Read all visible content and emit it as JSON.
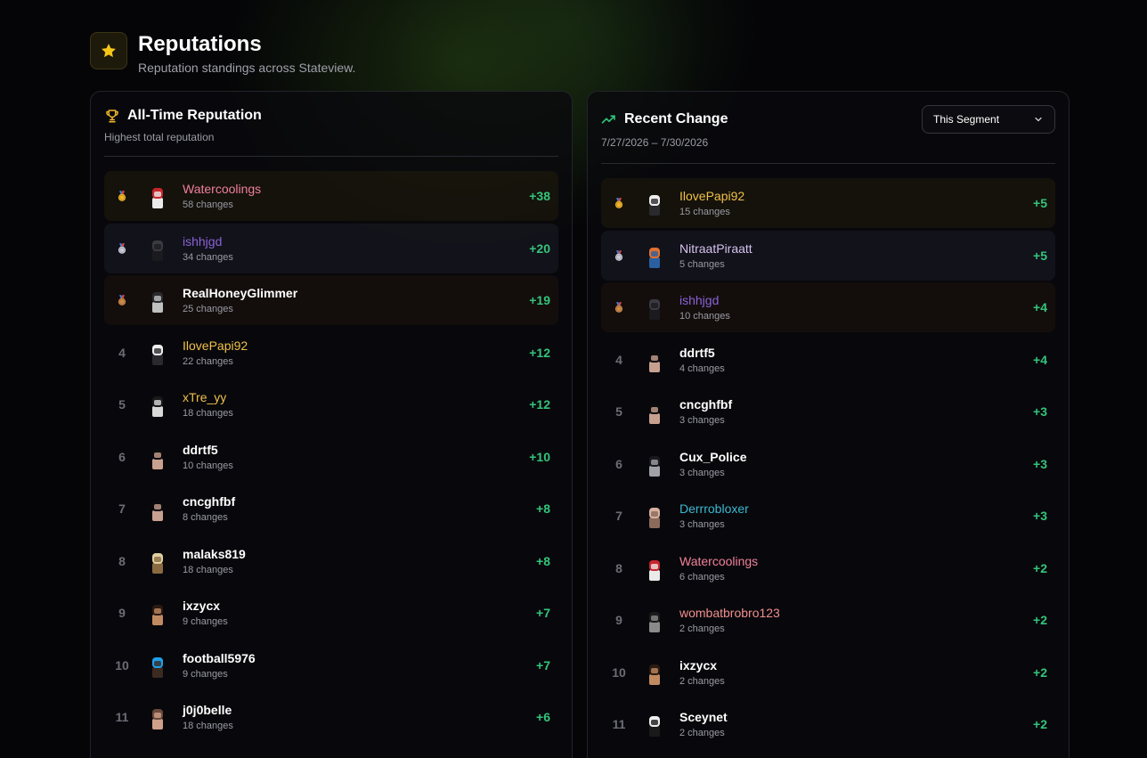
{
  "header": {
    "icon": "star-icon",
    "title": "Reputations",
    "subtitle": "Reputation standings across Stateview."
  },
  "all_time": {
    "icon": "trophy-icon",
    "title": "All-Time Reputation",
    "subtitle": "Highest total reputation",
    "rows": [
      {
        "rank": "1",
        "name": "Watercoolings",
        "changes": "58 changes",
        "delta": "+38",
        "medal": "gold"
      },
      {
        "rank": "2",
        "name": "ishhjgd",
        "changes": "34 changes",
        "delta": "+20",
        "medal": "silver"
      },
      {
        "rank": "3",
        "name": "RealHoneyGlimmer",
        "changes": "25 changes",
        "delta": "+19",
        "medal": "bronze"
      },
      {
        "rank": "4",
        "name": "IlovePapi92",
        "changes": "22 changes",
        "delta": "+12"
      },
      {
        "rank": "5",
        "name": "xTre_yy",
        "changes": "18 changes",
        "delta": "+12"
      },
      {
        "rank": "6",
        "name": "ddrtf5",
        "changes": "10 changes",
        "delta": "+10"
      },
      {
        "rank": "7",
        "name": "cncghfbf",
        "changes": "8 changes",
        "delta": "+8"
      },
      {
        "rank": "8",
        "name": "malaks819",
        "changes": "18 changes",
        "delta": "+8"
      },
      {
        "rank": "9",
        "name": "ixzycx",
        "changes": "9 changes",
        "delta": "+7"
      },
      {
        "rank": "10",
        "name": "football5976",
        "changes": "9 changes",
        "delta": "+7"
      },
      {
        "rank": "11",
        "name": "j0j0belle",
        "changes": "18 changes",
        "delta": "+6"
      }
    ]
  },
  "recent": {
    "icon": "trending-up-icon",
    "title": "Recent Change",
    "date_range": "7/27/2026 – 7/30/2026",
    "dropdown": {
      "selected": "This Segment"
    },
    "rows": [
      {
        "rank": "1",
        "name": "IlovePapi92",
        "changes": "15 changes",
        "delta": "+5",
        "medal": "gold"
      },
      {
        "rank": "2",
        "name": "NitraatPiraatt",
        "changes": "5 changes",
        "delta": "+5",
        "medal": "silver"
      },
      {
        "rank": "3",
        "name": "ishhjgd",
        "changes": "10 changes",
        "delta": "+4",
        "medal": "bronze"
      },
      {
        "rank": "4",
        "name": "ddrtf5",
        "changes": "4 changes",
        "delta": "+4"
      },
      {
        "rank": "5",
        "name": "cncghfbf",
        "changes": "3 changes",
        "delta": "+3"
      },
      {
        "rank": "6",
        "name": "Cux_Police",
        "changes": "3 changes",
        "delta": "+3"
      },
      {
        "rank": "7",
        "name": "Derrrobloxer",
        "changes": "3 changes",
        "delta": "+3"
      },
      {
        "rank": "8",
        "name": "Watercoolings",
        "changes": "6 changes",
        "delta": "+2"
      },
      {
        "rank": "9",
        "name": "wombatbrobro123",
        "changes": "2 changes",
        "delta": "+2"
      },
      {
        "rank": "10",
        "name": "ixzycx",
        "changes": "2 changes",
        "delta": "+2"
      },
      {
        "rank": "11",
        "name": "Sceynet",
        "changes": "2 changes",
        "delta": "+2"
      }
    ]
  },
  "colors": {
    "gain": "#34c47c",
    "gold": "#f0b429",
    "accent_green": "#2fc07a"
  }
}
